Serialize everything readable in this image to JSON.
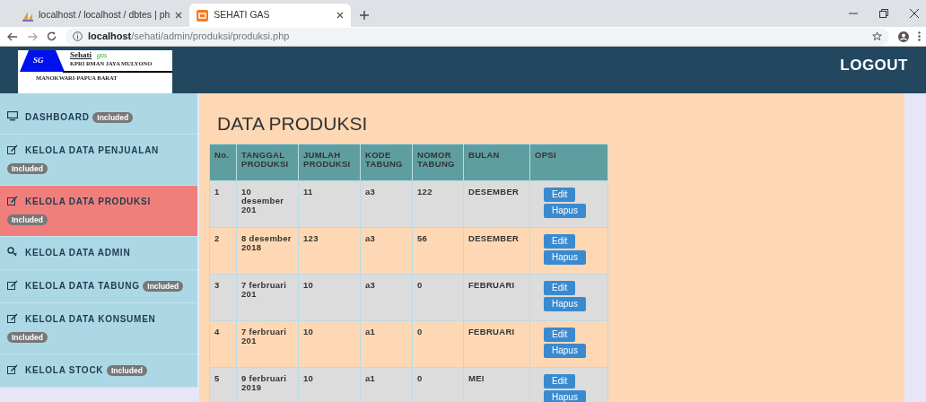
{
  "browser": {
    "tabs": [
      {
        "title": "localhost / localhost / dbtes | ph",
        "selected": false
      },
      {
        "title": "SEHATI GAS",
        "selected": true
      }
    ],
    "url_host": "localhost",
    "url_path": "/sehati/admin/produksi/produksi.php"
  },
  "header": {
    "logo": {
      "mark": "SG",
      "name": "Sehati",
      "tagline": "gas",
      "company": "KPRI RMAN JAYA MULYONO",
      "location": "MANOKWARI-PAPUA BARAT"
    },
    "logout": "LOGOUT"
  },
  "sidebar": {
    "items": [
      {
        "kind": "monitor",
        "label": "DASHBOARD",
        "badge": "Included",
        "selected": false
      },
      {
        "kind": "edit",
        "label": "KELOLA DATA PENJUALAN",
        "badge": "Included",
        "selected": false
      },
      {
        "kind": "edit",
        "label": "KELOLA DATA PRODUKSI",
        "badge": "Included",
        "selected": true
      },
      {
        "kind": "key",
        "label": "KELOLA DATA ADMIN",
        "selected": false
      },
      {
        "kind": "edit",
        "label": "KELOLA DATA TABUNG",
        "badge": "Included",
        "selected": false
      },
      {
        "kind": "edit",
        "label": "KELOLA DATA KONSUMEN",
        "badge": "Included",
        "selected": false
      },
      {
        "kind": "edit",
        "label": "KELOLA STOCK",
        "badge": "Included",
        "selected": false
      }
    ]
  },
  "page_title": "DATA PRODUKSI",
  "table": {
    "columns": [
      "No.",
      "TANGGAL PRODUKSI",
      "JUMLAH PRODUKSI",
      "KODE TABUNG",
      "NOMOR TABUNG",
      "BULAN",
      "OPSI"
    ],
    "rows": [
      {
        "cells": [
          "1",
          "10 desember 201",
          "11",
          "a3",
          "122",
          "DESEMBER"
        ],
        "buttons": [
          "Edit",
          "Hapus"
        ]
      },
      {
        "cells": [
          "2",
          "8 desember 2018",
          "123",
          "a3",
          "56",
          "DESEMBER"
        ],
        "buttons": [
          "Edit",
          "Hapus"
        ]
      },
      {
        "cells": [
          "3",
          "7 ferbruari 201",
          "10",
          "a3",
          "0",
          "FEBRUARI"
        ],
        "buttons": [
          "Edit",
          "Hapus"
        ]
      },
      {
        "cells": [
          "4",
          "7 ferbruari 201",
          "10",
          "a1",
          "0",
          "FEBRUARI"
        ],
        "buttons": [
          "Edit",
          "Hapus"
        ]
      },
      {
        "cells": [
          "5",
          "9 ferbruari 2019",
          "10",
          "a1",
          "0",
          "MEI"
        ],
        "buttons": [
          "Edit",
          "Hapus"
        ]
      }
    ]
  }
}
